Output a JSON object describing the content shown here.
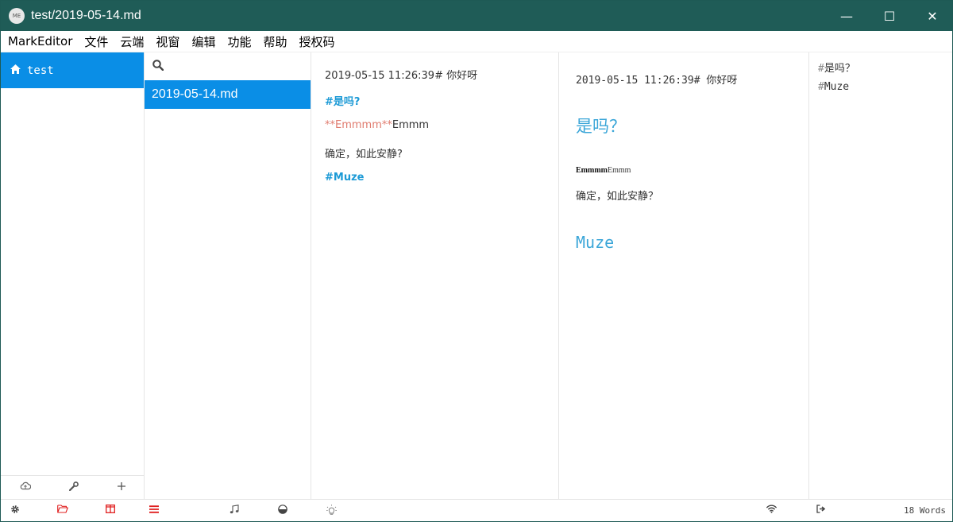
{
  "window": {
    "title": "test/2019-05-14.md",
    "icon_label": "ME"
  },
  "window_controls": {
    "minimize": "—",
    "maximize": "☐",
    "close": "✕"
  },
  "menu": [
    "MarkEditor",
    "文件",
    "云端",
    "视窗",
    "编辑",
    "功能",
    "帮助",
    "授权码"
  ],
  "sidebar": {
    "items": [
      {
        "label": "test",
        "icon": "home-icon",
        "selected": true
      }
    ]
  },
  "filelist": {
    "search_placeholder": "",
    "files": [
      {
        "name": "2019-05-14.md",
        "selected": true
      }
    ]
  },
  "editor": {
    "line1": "2019-05-15 11:26:39# 你好呀",
    "line2": "#是吗?",
    "line3_mark": "**Emmmm**",
    "line3_rest": "Emmm",
    "line4": "确定，如此安静?",
    "line5": "#Muze"
  },
  "preview": {
    "line1": "2019-05-15 11:26:39# 你好呀",
    "h1": "是吗？",
    "bold": "Emmmm",
    "bold_rest": "Emmm",
    "para": "确定，如此安静？",
    "h1b": "Muze"
  },
  "outline": {
    "items": [
      {
        "hash": "#",
        "text": "是吗？"
      },
      {
        "hash": "#",
        "text": "Muze"
      }
    ]
  },
  "status": {
    "words": "18 Words"
  },
  "colors": {
    "titlebar": "#1f5c57",
    "accent": "#0a8ee6",
    "heading": "#3ba6d8",
    "status_red": "#e02020"
  }
}
